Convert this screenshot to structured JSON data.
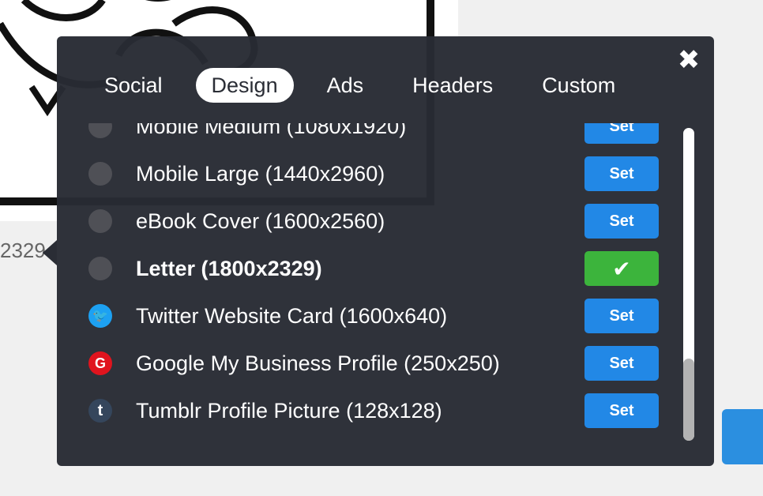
{
  "background": {
    "size_label": "2329"
  },
  "popup": {
    "close_glyph": "✖",
    "tabs": [
      {
        "label": "Social",
        "active": false
      },
      {
        "label": "Design",
        "active": true
      },
      {
        "label": "Ads",
        "active": false
      },
      {
        "label": "Headers",
        "active": false
      },
      {
        "label": "Custom",
        "active": false
      }
    ],
    "items": [
      {
        "label": "Mobile Medium (1080x1920)",
        "icon": "gray-dot-icon",
        "button": "Set",
        "selected": false
      },
      {
        "label": "Mobile Large (1440x2960)",
        "icon": "gray-dot-icon",
        "button": "Set",
        "selected": false
      },
      {
        "label": "eBook Cover (1600x2560)",
        "icon": "gray-dot-icon",
        "button": "Set",
        "selected": false
      },
      {
        "label": "Letter (1800x2329)",
        "icon": "gray-dot-icon",
        "button": "✔",
        "selected": true
      },
      {
        "label": "Twitter Website Card (1600x640)",
        "icon": "twitter-icon",
        "icon_glyph": "🐦",
        "button": "Set",
        "selected": false
      },
      {
        "label": "Google My Business Profile (250x250)",
        "icon": "google-icon",
        "icon_glyph": "G",
        "button": "Set",
        "selected": false
      },
      {
        "label": "Tumblr Profile Picture (128x128)",
        "icon": "tumblr-icon",
        "icon_glyph": "t",
        "button": "Set",
        "selected": false
      }
    ],
    "colors": {
      "set_button": "#2288e6",
      "selected_button": "#3cb43c",
      "popup_bg": "#2a2d35"
    }
  }
}
